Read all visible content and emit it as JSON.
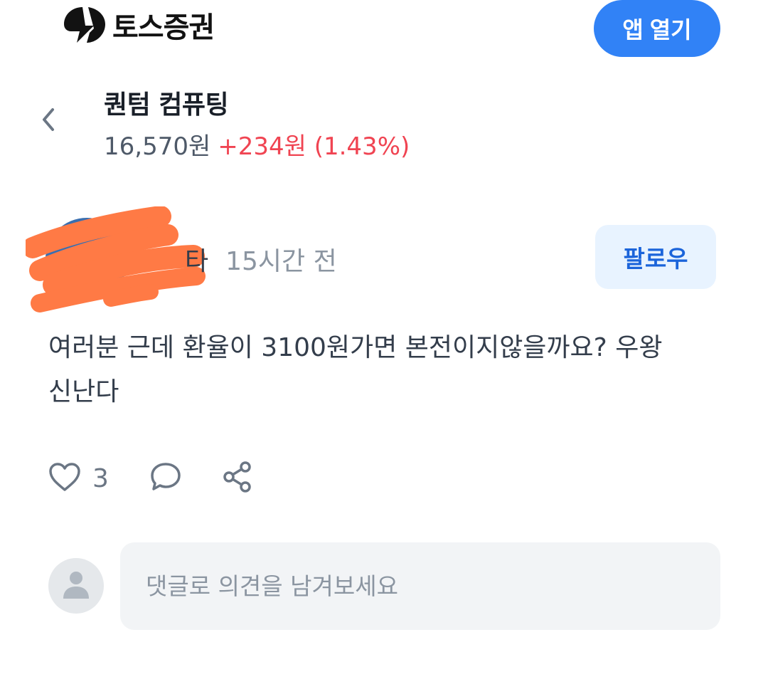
{
  "header": {
    "logo_text": "토스증권",
    "open_app_label": "앱 열기",
    "brand_color": "#3182f6"
  },
  "stock": {
    "name": "퀀텀 컴퓨팅",
    "price": "16,570원",
    "change": "+234원 (1.43%)",
    "change_color": "#f04452"
  },
  "post": {
    "author_visible_suffix": "타",
    "time": "15시간 전",
    "follow_label": "팔로우",
    "body": "여러분 근데 환율이 3100원가면 본전이지않을까요? 우왕 신난다",
    "like_count": "3",
    "icons": [
      "heart-icon",
      "comment-icon",
      "share-icon"
    ]
  },
  "comment": {
    "placeholder": "댓글로 의견을 남겨보세요"
  }
}
